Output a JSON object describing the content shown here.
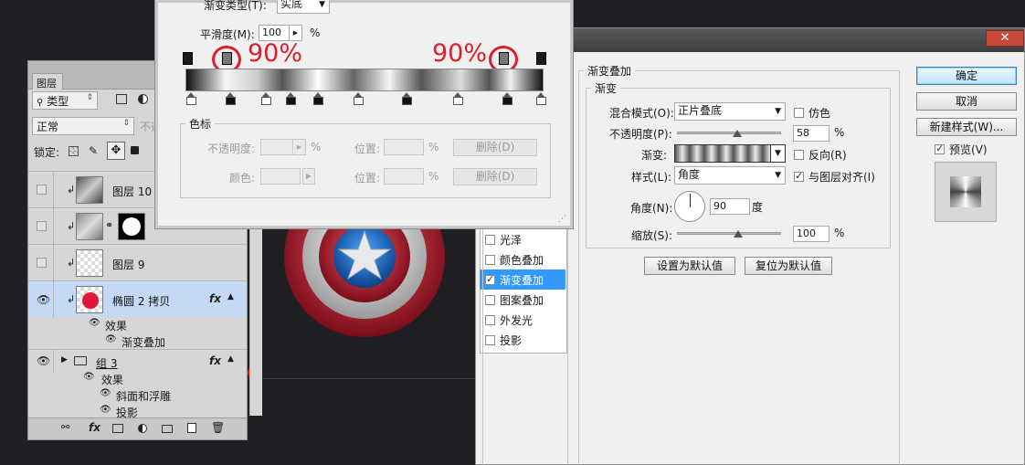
{
  "layers_panel": {
    "tab_label": "图层",
    "filter_label": "类型",
    "blend_mode": "正常",
    "opacity_label": "不透",
    "lock_label": "锁定:",
    "layers": [
      {
        "name": "图层 10",
        "visible": false
      },
      {
        "name": "",
        "visible": false
      },
      {
        "name": "图层 9",
        "visible": false
      },
      {
        "name": "椭圆 2 拷贝",
        "visible": true,
        "selected": true,
        "fx": "fx"
      },
      {
        "name": "组 3",
        "visible": true,
        "fx": "fx"
      }
    ],
    "effects_label_1": "效果",
    "gradient_overlay_effect": "渐变叠加",
    "effects_label_2": "效果",
    "bevel_emboss_effect": "斜面和浮雕",
    "shadow_effect": "投影"
  },
  "gradient_editor": {
    "gradient_type_label": "渐变类型(T):",
    "gradient_type_value": "实底",
    "smoothness_label": "平滑度(M):",
    "smoothness_value": "100",
    "percent": "%",
    "annotation_left": "90%",
    "annotation_right": "90%",
    "color_stops_title": "色标",
    "opacity_label": "不透明度:",
    "location_label": "位置:",
    "delete_label": "删除(D)",
    "color_label": "颜色:"
  },
  "layer_style": {
    "effects_list": [
      {
        "label": "光泽",
        "checked": false
      },
      {
        "label": "颜色叠加",
        "checked": false
      },
      {
        "label": "渐变叠加",
        "checked": true,
        "selected": true
      },
      {
        "label": "图案叠加",
        "checked": false
      },
      {
        "label": "外发光",
        "checked": false
      },
      {
        "label": "投影",
        "checked": false
      }
    ],
    "section_title": "渐变叠加",
    "group_title": "渐变",
    "blend_mode_label": "混合模式(O):",
    "blend_mode_value": "正片叠底",
    "dither_label": "仿色",
    "opacity_label": "不透明度(P):",
    "opacity_value": "58",
    "opacity_level": 0.58,
    "gradient_label": "渐变:",
    "reverse_label": "反向(R)",
    "style_label": "样式(L):",
    "style_value": "角度",
    "align_label": "与图层对齐(I)",
    "angle_label": "角度(N):",
    "angle_value": "90",
    "degree_unit": "度",
    "scale_label": "缩放(S):",
    "scale_value": "100",
    "percent": "%",
    "make_default": "设置为默认值",
    "reset_default": "复位为默认值",
    "ok_label": "确定",
    "cancel_label": "取消",
    "new_style_label": "新建样式(W)...",
    "preview_label": "预览(V)",
    "close_glyph": "✕"
  },
  "colors": {
    "annotation_red": "#e01e2b",
    "selection_blue": "#3399ff",
    "canvas_bg": "#1f1f24"
  }
}
